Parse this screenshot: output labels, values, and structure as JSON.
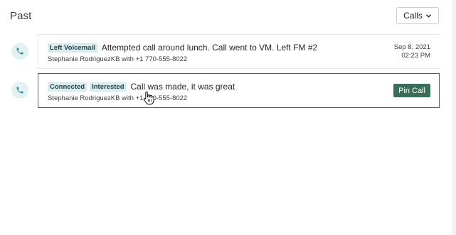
{
  "header": {
    "title": "Past",
    "filter_label": "Calls"
  },
  "calls": [
    {
      "badges": [
        "Left Voicemail"
      ],
      "note": "Attempted call around lunch. Call went to VM. Left FM #2",
      "meta": "Stephanie RodriguezKB with +1 770-555-8022",
      "date": "Sep 8, 2021",
      "time": "02:23 PM"
    },
    {
      "badges": [
        "Connected",
        "Interested"
      ],
      "note": "Call was made, it was great",
      "meta": "Stephanie RodriguezKB with +1 770-555-8022",
      "pin_label": "Pin Call"
    }
  ],
  "colors": {
    "badge_bg": "#d8ecef",
    "icon_bg": "#e4f1f3",
    "icon_fg": "#2a8fa0",
    "pin_button": "#3a6e58"
  },
  "icons": {
    "call_type": "phone-icon",
    "filter_dropdown": "chevron-down-icon",
    "pointer": "hand-cursor-icon"
  }
}
